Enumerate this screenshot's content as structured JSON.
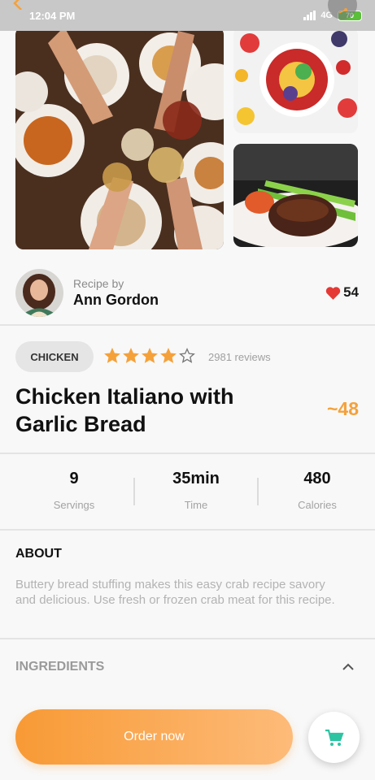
{
  "status_bar": {
    "time": "12:04 PM",
    "network": "4G",
    "battery": "70"
  },
  "author": {
    "prefix": "Recipe by",
    "name": "Ann Gordon",
    "likes": "54"
  },
  "recipe": {
    "category": "CHICKEN",
    "rating": 4,
    "rating_max": 5,
    "reviews": "2981 reviews",
    "title": "Chicken Italiano with Garlic Bread",
    "price": "~48"
  },
  "stats": [
    {
      "value": "9",
      "label": "Servings"
    },
    {
      "value": "35min",
      "label": "Time"
    },
    {
      "value": "480",
      "label": "Calories"
    }
  ],
  "about": {
    "heading": "ABOUT",
    "text": "Buttery bread stuffing makes this easy crab recipe savory and delicious. Use fresh or frozen crab meat for this recipe."
  },
  "ingredients": {
    "heading": "INGREDIENTS"
  },
  "actions": {
    "order_label": "Order now"
  },
  "colors": {
    "accent": "#f5a13a",
    "heart": "#e53935",
    "cart": "#2ec4a2"
  }
}
